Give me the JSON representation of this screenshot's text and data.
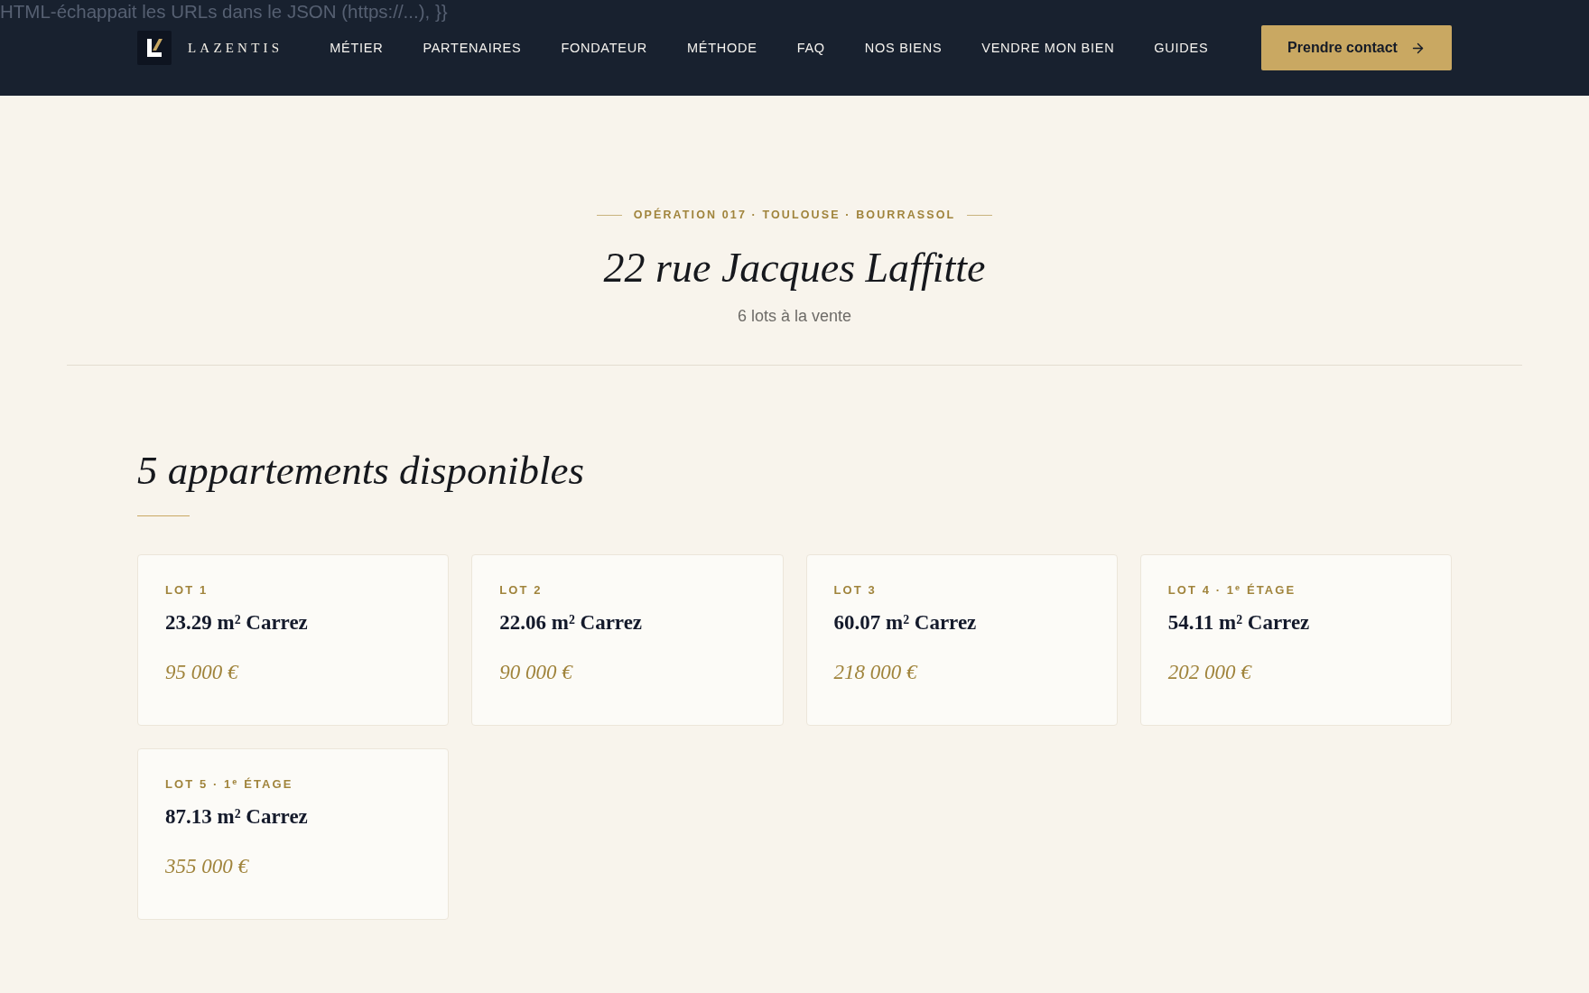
{
  "stray_text": "HTML-échappait les URLs dans le JSON (https://...), }}",
  "header": {
    "brand": "LAZENTIS",
    "nav": [
      "MÉTIER",
      "PARTENAIRES",
      "FONDATEUR",
      "MÉTHODE",
      "FAQ",
      "NOS BIENS",
      "VENDRE MON BIEN",
      "GUIDES"
    ],
    "cta": "Prendre contact"
  },
  "hero": {
    "eyebrow": "OPÉRATION 017 · TOULOUSE · BOURRASSOL",
    "title": "22 rue Jacques Laffitte",
    "subtitle": "6 lots à la vente"
  },
  "listing": {
    "heading": "5 appartements disponibles",
    "lots": [
      {
        "label": "LOT 1",
        "area": "23.29 m² Carrez",
        "price": "95 000 €"
      },
      {
        "label": "LOT 2",
        "area": "22.06 m² Carrez",
        "price": "90 000 €"
      },
      {
        "label": "LOT 3",
        "area": "60.07 m² Carrez",
        "price": "218 000 €"
      },
      {
        "label": "LOT 4 · 1$^{e}$ ÉTAGE",
        "area": "54.11 m² Carrez",
        "price": "202 000 €"
      },
      {
        "label": "LOT 5 · 1$^{e}$ ÉTAGE",
        "area": "87.13 m² Carrez",
        "price": "355 000 €"
      }
    ]
  }
}
